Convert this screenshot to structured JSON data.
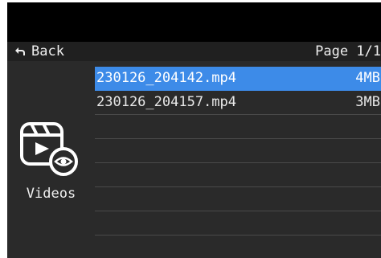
{
  "header": {
    "back_label": "Back",
    "page_indicator": "Page 1/1"
  },
  "sidebar": {
    "folder_label": "Videos",
    "folder_icon": "video-folder-icon"
  },
  "files": [
    {
      "name": "230126_204142.mp4",
      "size": "4MB",
      "selected": true
    },
    {
      "name": "230126_204157.mp4",
      "size": "3MB",
      "selected": false
    }
  ],
  "colors": {
    "selection": "#3d8be8",
    "panel": "#2a2a2a",
    "header": "#202020"
  }
}
